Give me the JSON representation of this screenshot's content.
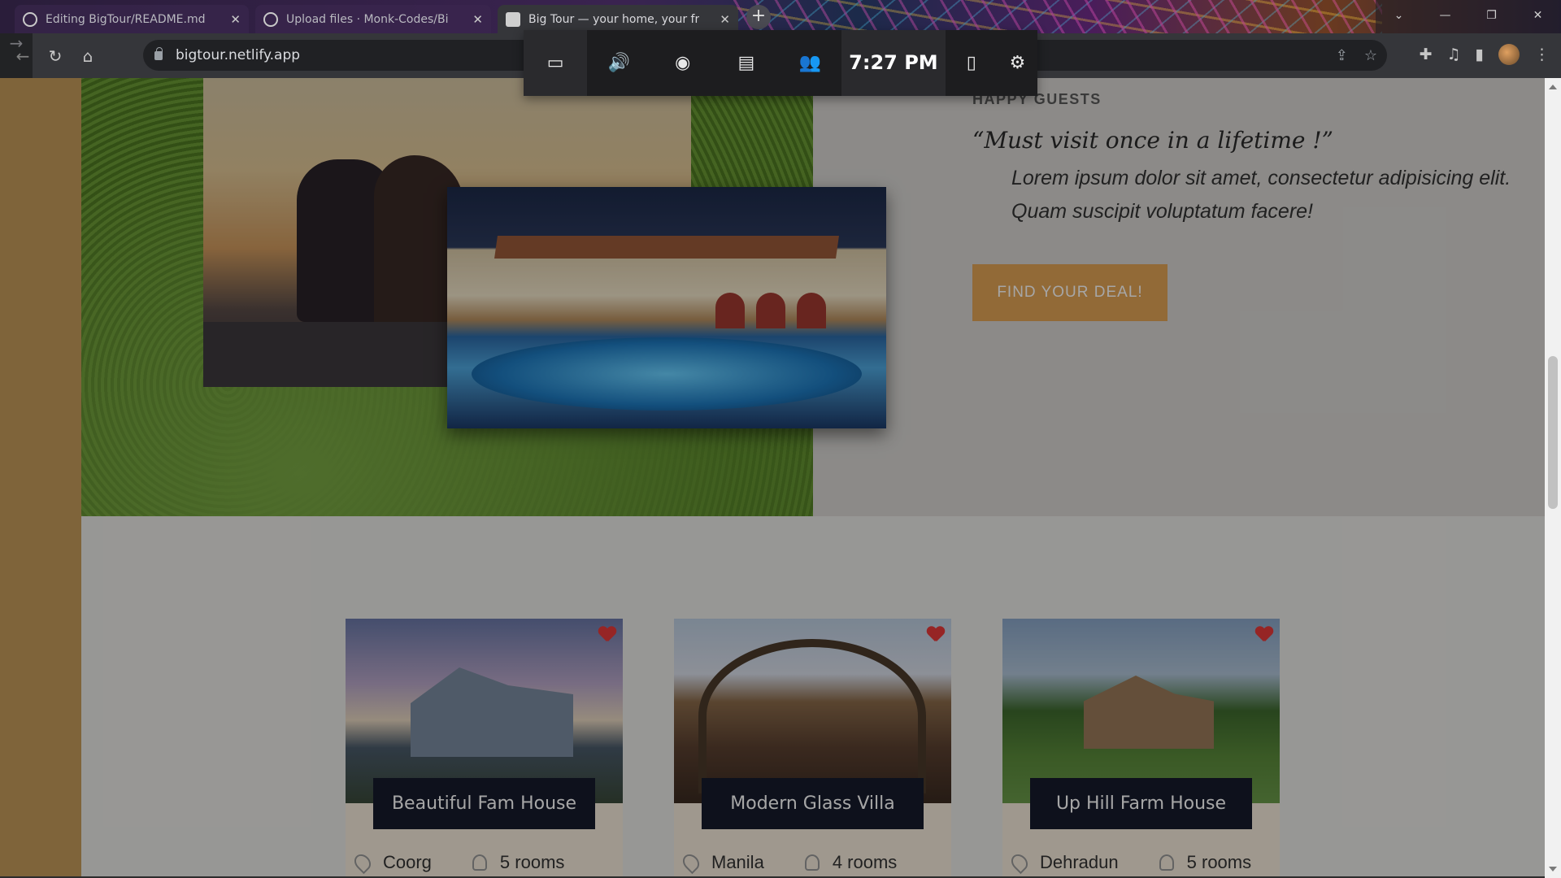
{
  "browser": {
    "tabs": [
      {
        "title": "Editing BigTour/README.md at",
        "active": false,
        "favicon": "github-icon"
      },
      {
        "title": "Upload files · Monk-Codes/BigT",
        "active": false,
        "favicon": "github-icon"
      },
      {
        "title": "Big Tour — your home, your free",
        "active": true,
        "favicon": "page-icon"
      }
    ],
    "new_tab": "+",
    "window_controls": {
      "dropdown": "⌄",
      "minimize": "—",
      "restore": "❐",
      "close": "✕"
    },
    "url": "bigtour.netlify.app"
  },
  "gamebar": {
    "time": "7:27 PM"
  },
  "page": {
    "happy_guests": "HAPPY GUESTS",
    "quote_title": "“Must visit once in a lifetime !”",
    "quote_text": "Lorem ipsum dolor sit amet, consectetur adipisicing elit. Quam suscipit voluptatum facere!",
    "cta": "FIND YOUR DEAL!"
  },
  "properties": [
    {
      "name": "Beautiful Fam House",
      "location": "Coorg",
      "rooms": "5 rooms"
    },
    {
      "name": "Modern Glass Villa",
      "location": "Manila",
      "rooms": "4 rooms"
    },
    {
      "name": "Up Hill Farm House",
      "location": "Dehradun",
      "rooms": "5 rooms"
    }
  ],
  "colors": {
    "accent": "#e0a355",
    "card_label_bg": "#161b2c",
    "heart": "#e63a3a"
  }
}
